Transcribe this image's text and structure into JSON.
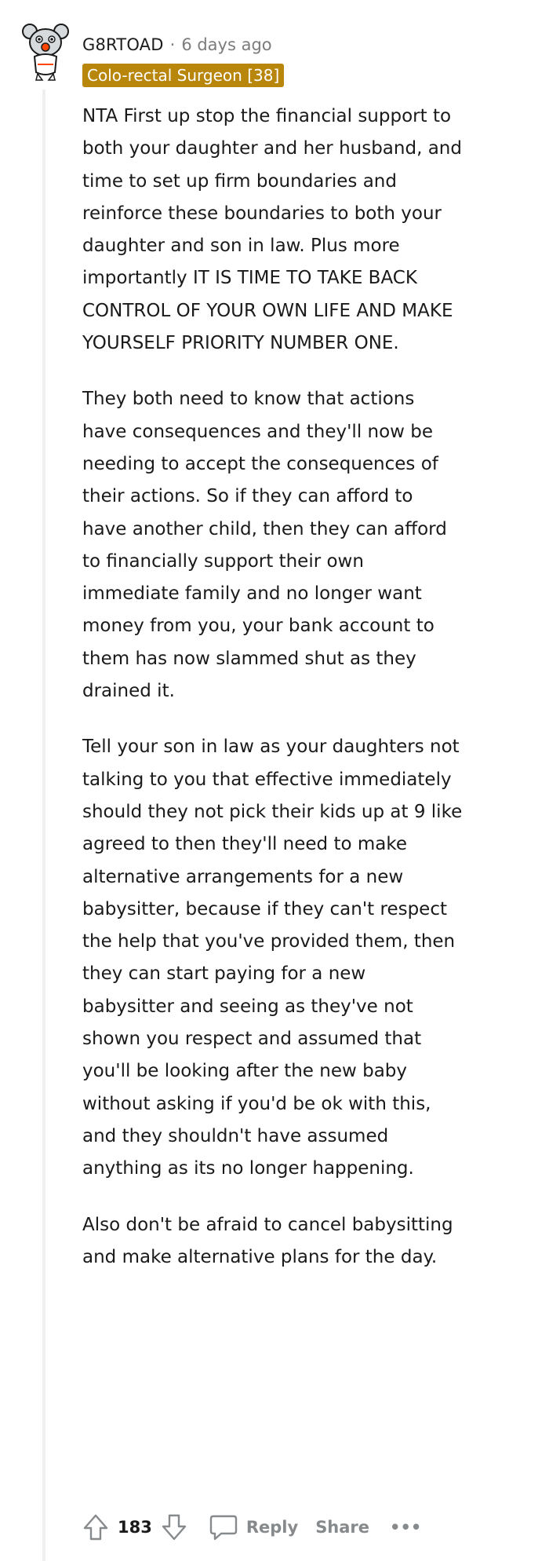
{
  "comment": {
    "username": "G8RTOAD",
    "separator": "·",
    "timestamp": "6 days ago",
    "flair": "Colo-rectal Surgeon [38]",
    "paragraphs": [
      "NTA First up stop the financial support to both your daughter and her husband, and time to set up firm boundaries and reinforce these boundaries to both your daughter and son in law. Plus more importantly IT IS TIME TO TAKE BACK CONTROL OF YOUR OWN LIFE AND MAKE YOURSELF PRIORITY NUMBER ONE.",
      "They both need to know that actions have consequences and they'll now be needing to accept the consequences of their actions. So if they can afford to have another child, then they can afford to financially support their own immediate family and no longer want money from you, your bank account to them has now slammed shut as they drained it.",
      "Tell your son in law as your daughters not talking to you that effective immediately should they not pick their kids up at 9 like agreed to then they'll need to make alternative arrangements for a new babysitter, because if they can't respect the help that you've provided them, then they can start paying for a new babysitter and seeing as they've not shown you respect and assumed that you'll be looking after the new baby without asking if you'd be ok with this, and they shouldn't have assumed anything as its no longer happening.",
      "Also don't be afraid to cancel babysitting and make alternative plans for the day."
    ],
    "score": "183",
    "reply_label": "Reply",
    "share_label": "Share",
    "more_label": "•••"
  },
  "icons": {
    "avatar": "snoo-avatar-icon",
    "upvote": "upvote-arrow-icon",
    "downvote": "downvote-arrow-icon",
    "reply": "speech-bubble-icon",
    "more": "ellipsis-icon"
  },
  "colors": {
    "flair_bg": "#b8860b",
    "flair_text": "#ffffff",
    "muted": "#878a8c",
    "thread_line": "#edeff1"
  }
}
